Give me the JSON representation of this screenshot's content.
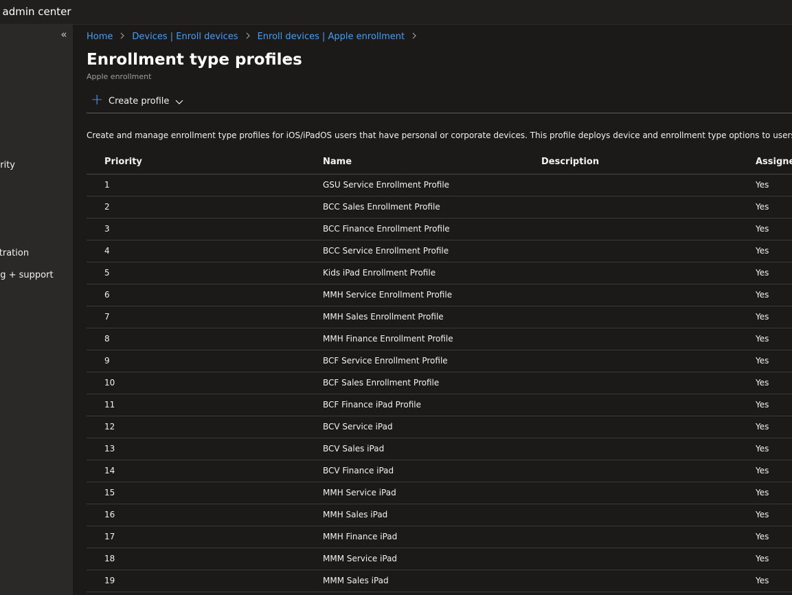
{
  "app": {
    "title": "ne admin center"
  },
  "sidebar": {
    "collapse_label": "«",
    "items": [
      {
        "label": "urity"
      },
      {
        "label": "stration"
      },
      {
        "label": "ng + support"
      }
    ]
  },
  "breadcrumb": {
    "items": [
      {
        "label": "Home"
      },
      {
        "label": "Devices | Enroll devices"
      },
      {
        "label": "Enroll devices | Apple enrollment"
      }
    ],
    "separator": ">"
  },
  "page": {
    "title": "Enrollment type profiles",
    "more_label": "···",
    "subtitle": "Apple enrollment"
  },
  "toolbar": {
    "create_label": "Create profile",
    "plus_glyph": "+"
  },
  "description": "Create and manage enrollment type profiles for iOS/iPadOS users that have personal or corporate devices. This profile deploys device and enrollment type options to users set",
  "table": {
    "columns": {
      "priority": "Priority",
      "name": "Name",
      "description": "Description",
      "assigned": "Assigne"
    },
    "rows": [
      {
        "priority": "1",
        "name": "GSU Service Enrollment Profile",
        "description": "",
        "assigned": "Yes"
      },
      {
        "priority": "2",
        "name": "BCC Sales Enrollment Profile",
        "description": "",
        "assigned": "Yes"
      },
      {
        "priority": "3",
        "name": "BCC Finance Enrollment Profile",
        "description": "",
        "assigned": "Yes"
      },
      {
        "priority": "4",
        "name": "BCC Service Enrollment Profile",
        "description": "",
        "assigned": "Yes"
      },
      {
        "priority": "5",
        "name": "Kids iPad Enrollment Profile",
        "description": "",
        "assigned": "Yes"
      },
      {
        "priority": "6",
        "name": "MMH Service Enrollment Profile",
        "description": "",
        "assigned": "Yes"
      },
      {
        "priority": "7",
        "name": "MMH Sales Enrollment Profile",
        "description": "",
        "assigned": "Yes"
      },
      {
        "priority": "8",
        "name": "MMH Finance Enrollment Profile",
        "description": "",
        "assigned": "Yes"
      },
      {
        "priority": "9",
        "name": "BCF Service Enrollment Profile",
        "description": "",
        "assigned": "Yes"
      },
      {
        "priority": "10",
        "name": "BCF Sales Enrollment Profile",
        "description": "",
        "assigned": "Yes"
      },
      {
        "priority": "11",
        "name": "BCF Finance iPad Profile",
        "description": "",
        "assigned": "Yes"
      },
      {
        "priority": "12",
        "name": "BCV Service iPad",
        "description": "",
        "assigned": "Yes"
      },
      {
        "priority": "13",
        "name": "BCV Sales iPad",
        "description": "",
        "assigned": "Yes"
      },
      {
        "priority": "14",
        "name": "BCV Finance iPad",
        "description": "",
        "assigned": "Yes"
      },
      {
        "priority": "15",
        "name": "MMH Service iPad",
        "description": "",
        "assigned": "Yes"
      },
      {
        "priority": "16",
        "name": "MMH Sales iPad",
        "description": "",
        "assigned": "Yes"
      },
      {
        "priority": "17",
        "name": "MMH Finance iPad",
        "description": "",
        "assigned": "Yes"
      },
      {
        "priority": "18",
        "name": "MMM Service iPad",
        "description": "",
        "assigned": "Yes"
      },
      {
        "priority": "19",
        "name": "MMM Sales iPad",
        "description": "",
        "assigned": "Yes"
      }
    ]
  }
}
